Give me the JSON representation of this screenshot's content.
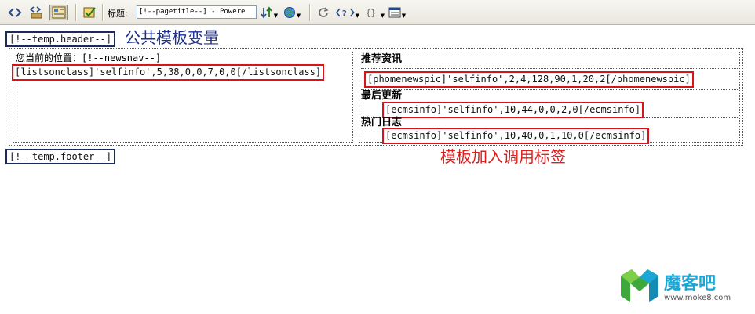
{
  "toolbar": {
    "title_label": "标题:",
    "title_value": "[!--pagetitle--] - Powere",
    "icons": [
      "code-view-icon",
      "split-view-icon",
      "design-view-icon",
      "validate-icon",
      "file-transfer-icon",
      "browser-preview-icon",
      "refresh-icon",
      "code-navigation-icon",
      "braces-icon",
      "view-options-icon"
    ]
  },
  "canvas": {
    "header_tag": "[!--temp.header--]",
    "header_annotation": "公共模板变量",
    "position_text": "您当前的位置：[!--newsnav--]",
    "listsonclass_tag": "[listsonclass]'selfinfo',5,38,0,0,7,0,0[/listsonclass]",
    "recommend_heading": "推荐资讯",
    "phonenewspic_tag": "[phomenewspic]'selfinfo',2,4,128,90,1,20,2[/phomenewspic]",
    "latest_heading": "最后更新",
    "ecmsinfo_latest_tag": "[ecmsinfo]'selfinfo',10,44,0,0,2,0[/ecmsinfo]",
    "hot_heading": "热门日志",
    "ecmsinfo_hot_tag": "[ecmsinfo]'selfinfo',10,40,0,1,10,0[/ecmsinfo]",
    "footer_tag": "[!--temp.footer--]",
    "call_tag_annotation": "模板加入调用标签"
  },
  "watermark": {
    "brand": "魔客吧",
    "url": "www.moke8.com"
  },
  "colors": {
    "navy_border": "#1b2a5c",
    "red_border": "#d8141a",
    "blue_annotation": "#1c2e8e",
    "red_annotation": "#e21b1b"
  }
}
